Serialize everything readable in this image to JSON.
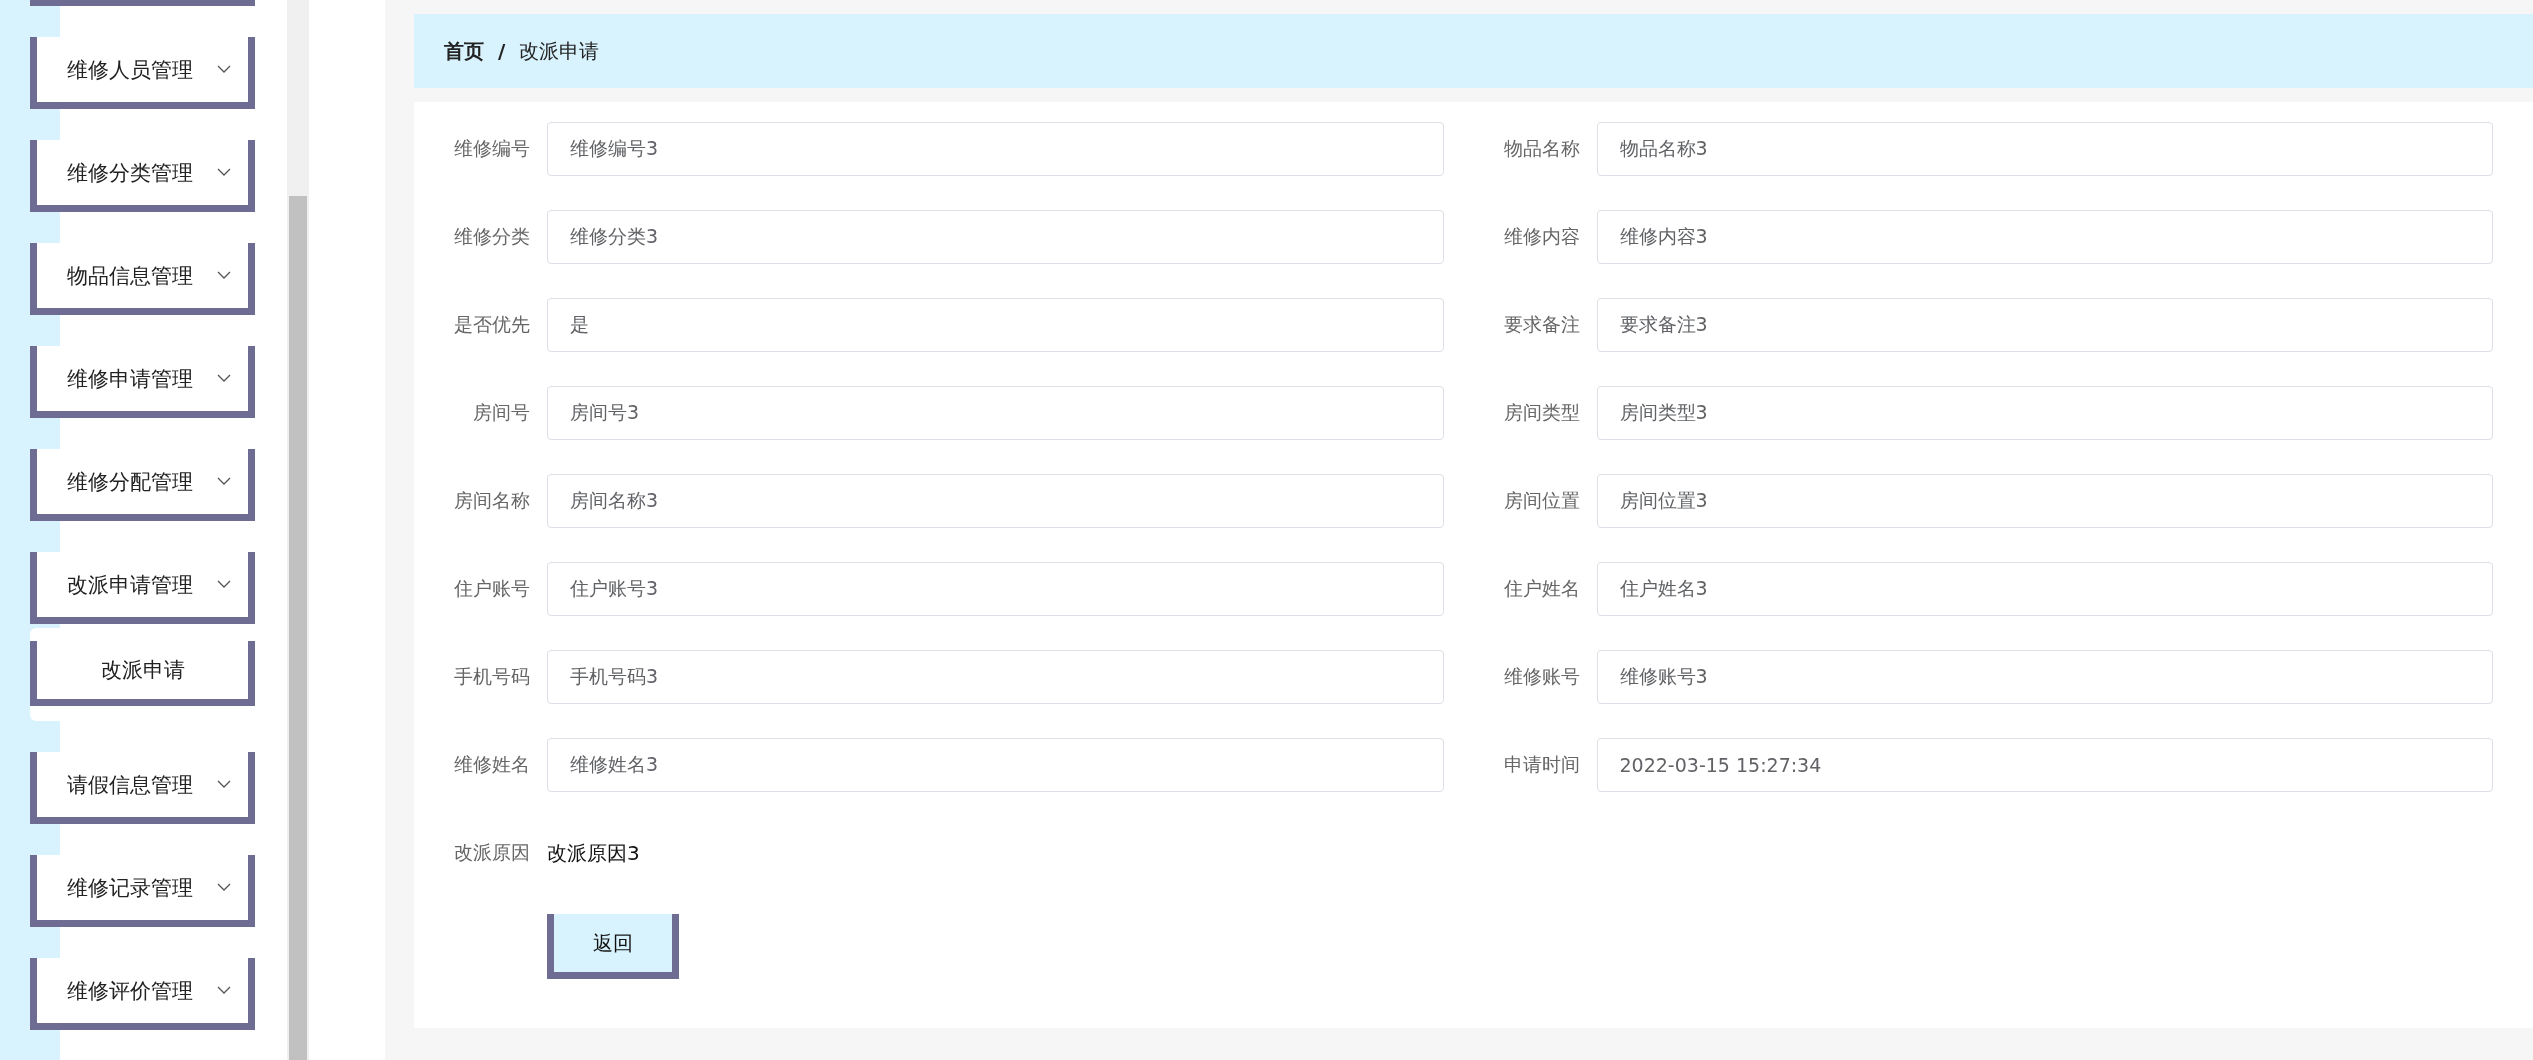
{
  "sidebar": {
    "items": [
      {
        "label": "维修人员管理"
      },
      {
        "label": "维修分类管理"
      },
      {
        "label": "物品信息管理"
      },
      {
        "label": "维修申请管理"
      },
      {
        "label": "维修分配管理"
      },
      {
        "label": "改派申请管理",
        "children": [
          {
            "label": "改派申请"
          }
        ]
      },
      {
        "label": "请假信息管理"
      },
      {
        "label": "维修记录管理"
      },
      {
        "label": "维修评价管理"
      }
    ]
  },
  "breadcrumb": [
    "首页",
    "/",
    "改派申请"
  ],
  "form": {
    "fields": [
      {
        "kind": "input",
        "label": "维修编号",
        "value": "维修编号3"
      },
      {
        "kind": "input",
        "label": "物品名称",
        "value": "物品名称3"
      },
      {
        "kind": "input",
        "label": "维修分类",
        "value": "维修分类3"
      },
      {
        "kind": "input",
        "label": "维修内容",
        "value": "维修内容3"
      },
      {
        "kind": "input",
        "label": "是否优先",
        "value": "是"
      },
      {
        "kind": "input",
        "label": "要求备注",
        "value": "要求备注3"
      },
      {
        "kind": "input",
        "label": "房间号",
        "value": "房间号3"
      },
      {
        "kind": "input",
        "label": "房间类型",
        "value": "房间类型3"
      },
      {
        "kind": "input",
        "label": "房间名称",
        "value": "房间名称3"
      },
      {
        "kind": "input",
        "label": "房间位置",
        "value": "房间位置3"
      },
      {
        "kind": "input",
        "label": "住户账号",
        "value": "住户账号3"
      },
      {
        "kind": "input",
        "label": "住户姓名",
        "value": "住户姓名3"
      },
      {
        "kind": "input",
        "label": "手机号码",
        "value": "手机号码3"
      },
      {
        "kind": "input",
        "label": "维修账号",
        "value": "维修账号3"
      },
      {
        "kind": "input",
        "label": "维修姓名",
        "value": "维修姓名3"
      },
      {
        "kind": "input",
        "label": "申请时间",
        "value": "2022-03-15 15:27:34"
      },
      {
        "kind": "text",
        "label": "改派原因",
        "value": "改派原因3"
      }
    ],
    "buttons": [
      "返回"
    ]
  }
}
